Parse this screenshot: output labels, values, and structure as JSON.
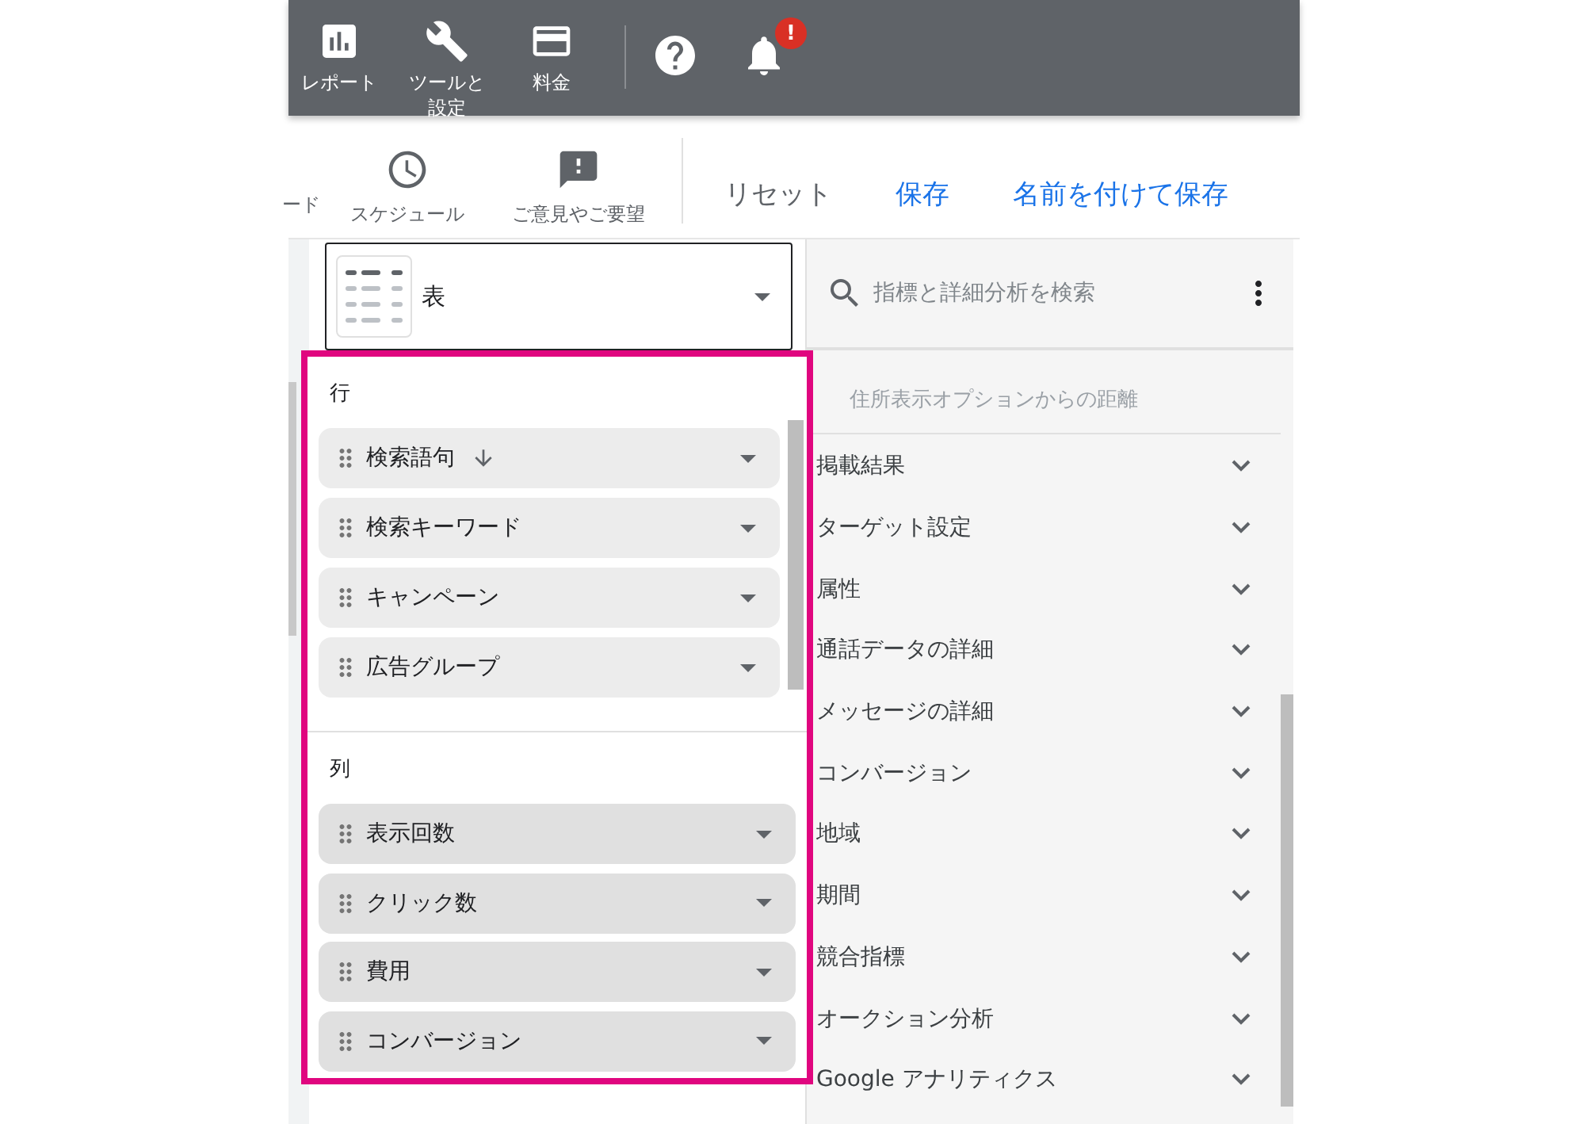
{
  "top_nav": {
    "items": [
      {
        "label": "レポート",
        "kind": "reports"
      },
      {
        "label": "ツールと設定",
        "kind": "tools"
      },
      {
        "label": "料金",
        "kind": "billing"
      }
    ],
    "notification_badge": "!"
  },
  "toolbar": {
    "items": [
      {
        "label": "ード",
        "kind": "cut"
      },
      {
        "label": "スケジュール",
        "kind": "schedule"
      },
      {
        "label": "ご意見やご要望",
        "kind": "feedback"
      }
    ],
    "actions": [
      {
        "label": "リセット",
        "kind": "secondary"
      },
      {
        "label": "保存",
        "kind": "primary"
      },
      {
        "label": "名前を付けて保存",
        "kind": "primary"
      }
    ]
  },
  "chart_type": {
    "label": "表"
  },
  "rows": {
    "title": "行",
    "items": [
      {
        "label": "検索語句",
        "sorted": true
      },
      {
        "label": "検索キーワード",
        "sorted": false
      },
      {
        "label": "キャンペーン",
        "sorted": false
      },
      {
        "label": "広告グループ",
        "sorted": false
      }
    ]
  },
  "columns": {
    "title": "列",
    "items": [
      {
        "label": "表示回数"
      },
      {
        "label": "クリック数"
      },
      {
        "label": "費用"
      },
      {
        "label": "コンバージョン"
      }
    ]
  },
  "search": {
    "placeholder": "指標と詳細分析を検索"
  },
  "faded_item": "住所表示オプションからの距離",
  "categories": [
    {
      "label": "掲載結果",
      "expanded": false
    },
    {
      "label": "ターゲット設定",
      "expanded": false
    },
    {
      "label": "属性",
      "expanded": false
    },
    {
      "label": "通話データの詳細",
      "expanded": false
    },
    {
      "label": "メッセージの詳細",
      "expanded": false
    },
    {
      "label": "コンバージョン",
      "expanded": false
    },
    {
      "label": "地域",
      "expanded": false
    },
    {
      "label": "期間",
      "expanded": false
    },
    {
      "label": "競合指標",
      "expanded": false
    },
    {
      "label": "オークション分析",
      "expanded": false
    },
    {
      "label": "Google アナリティクス",
      "expanded": false
    }
  ]
}
